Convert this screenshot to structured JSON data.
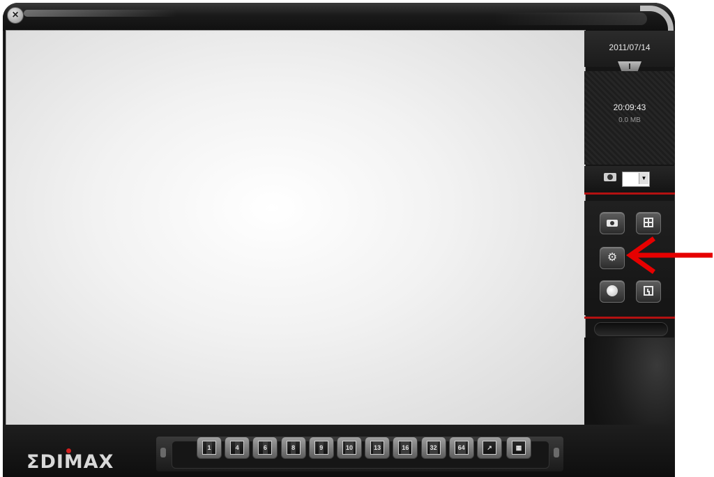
{
  "window": {
    "close_label": "×"
  },
  "status": {
    "date": "2011/07/14",
    "time": "20:09:43",
    "size": "0.0 MB"
  },
  "camera_select": {
    "value": ""
  },
  "side_buttons": [
    {
      "name": "snapshot",
      "icon": "camera-icon"
    },
    {
      "name": "layout",
      "icon": "grid-icon"
    },
    {
      "name": "settings",
      "icon": "gear-icon"
    },
    {
      "name": "record",
      "icon": "record-icon"
    },
    {
      "name": "schedule",
      "icon": "clock-icon"
    }
  ],
  "brand": {
    "logo_text": "ΣDIMAX"
  },
  "split_buttons": [
    "1",
    "4",
    "6",
    "8",
    "9",
    "10",
    "13",
    "16",
    "32",
    "64"
  ],
  "annotation": {
    "color": "#e60000"
  }
}
